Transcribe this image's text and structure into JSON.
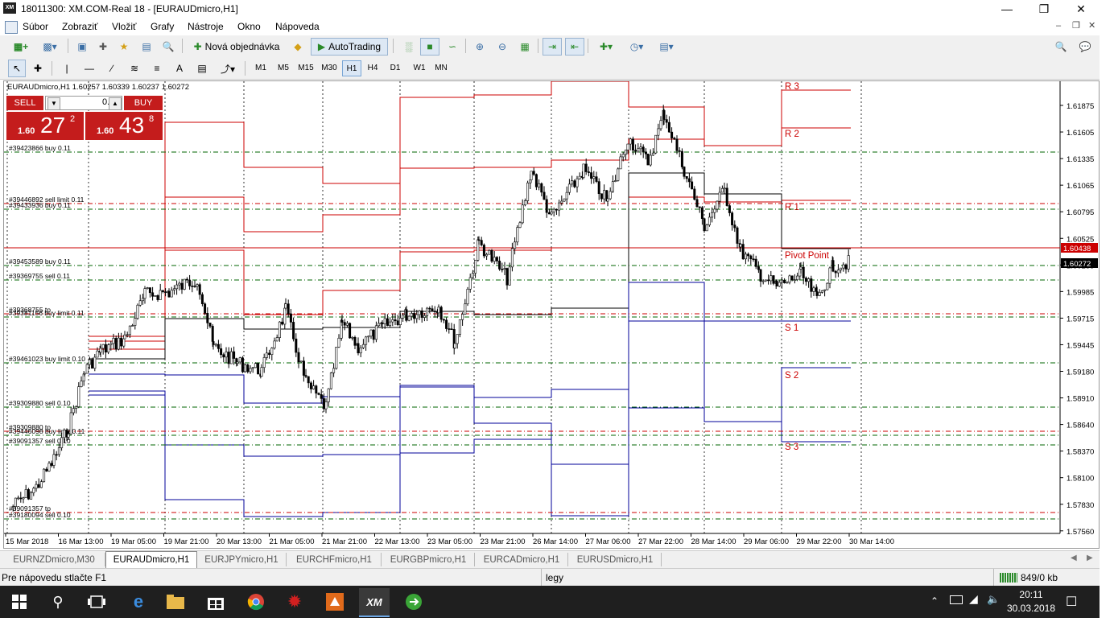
{
  "window": {
    "title": "18011300: XM.COM-Real 18 - [EURAUDmicro,H1]",
    "logo": "XM",
    "controls": [
      "minimize-icon",
      "restore-icon",
      "close-icon"
    ]
  },
  "menu": [
    "Súbor",
    "Zobraziť",
    "Vložiť",
    "Grafy",
    "Nástroje",
    "Okno",
    "Nápoveda"
  ],
  "toolbar": {
    "new_order": "Nová objednávka",
    "autotrading": "AutoTrading"
  },
  "timeframes": [
    "M1",
    "M5",
    "M15",
    "M30",
    "H1",
    "H4",
    "D1",
    "W1",
    "MN"
  ],
  "active_timeframe": "H1",
  "chart": {
    "header": "EURAUDmicro,H1  1.60257 1.60339 1.60237 1.60272",
    "price_ticks": [
      "1.61875",
      "1.61605",
      "1.61335",
      "1.61065",
      "1.60795",
      "1.60525",
      "1.60255",
      "1.59985",
      "1.59715",
      "1.59445",
      "1.59180",
      "1.58910",
      "1.58640",
      "1.58370",
      "1.58100",
      "1.57830",
      "1.57560"
    ],
    "time_ticks": [
      "15 Mar 2018",
      "16 Mar 13:00",
      "19 Mar 05:00",
      "19 Mar 21:00",
      "20 Mar 13:00",
      "21 Mar 05:00",
      "21 Mar 21:00",
      "22 Mar 13:00",
      "23 Mar 05:00",
      "23 Mar 21:00",
      "26 Mar 14:00",
      "27 Mar 06:00",
      "27 Mar 22:00",
      "28 Mar 14:00",
      "29 Mar 06:00",
      "29 Mar 22:00",
      "30 Mar 14:00"
    ],
    "ask_price_label": "1.60438",
    "bid_price_label": "1.60272",
    "pivot_labels": [
      "R 3",
      "R 2",
      "R 1",
      "Pivot Point",
      "S 1",
      "S 2",
      "S 3"
    ],
    "order_labels": [
      "#39423866 buy 0.11",
      "#39446892 sell limit 0.11",
      "#39433936 buy 0.11",
      "#39453589 buy 0.11",
      "#39369755 sell 0.11",
      "#39368755 tp",
      "#39381156 buy limit 0.11",
      "#39461023 buy limit 0.10",
      "#39309880 sell 0.10",
      "#39309880 tp",
      "#39446098 buy limit 0.11",
      "#39091357 sell 0.10",
      "#39091357 tp",
      "#39180094 sell 0.10"
    ]
  },
  "oneclick": {
    "sell_label": "SELL",
    "buy_label": "BUY",
    "volume": "0.11",
    "sell_prefix": "1.60",
    "sell_big": "27",
    "sell_sup": "2",
    "buy_prefix": "1.60",
    "buy_big": "43",
    "buy_sup": "8"
  },
  "tabs": [
    "EURNZDmicro,M30",
    "EURAUDmicro,H1",
    "EURJPYmicro,H1",
    "EURCHFmicro,H1",
    "EURGBPmicro,H1",
    "EURCADmicro,H1",
    "EURUSDmicro,H1"
  ],
  "active_tab": "EURAUDmicro,H1",
  "status": {
    "help": "Pre nápovedu stlačte F1",
    "profile": "legy",
    "traffic": "849/0 kb"
  },
  "taskbar": {
    "time": "20:11",
    "date": "30.03.2018",
    "apps": [
      "start-icon",
      "search-icon",
      "task-view-icon",
      "edge-icon",
      "file-explorer-icon",
      "store-icon",
      "chrome-icon",
      "red-app-icon",
      "orange-app-icon",
      "xm-app-icon",
      "green-app-icon"
    ]
  },
  "colors": {
    "resistance": "#cc0000",
    "support": "#000099",
    "pivot": "#000000",
    "ask_line": "#cc0000",
    "order_line": "#006600",
    "taskbar": "#1f1f1f"
  }
}
